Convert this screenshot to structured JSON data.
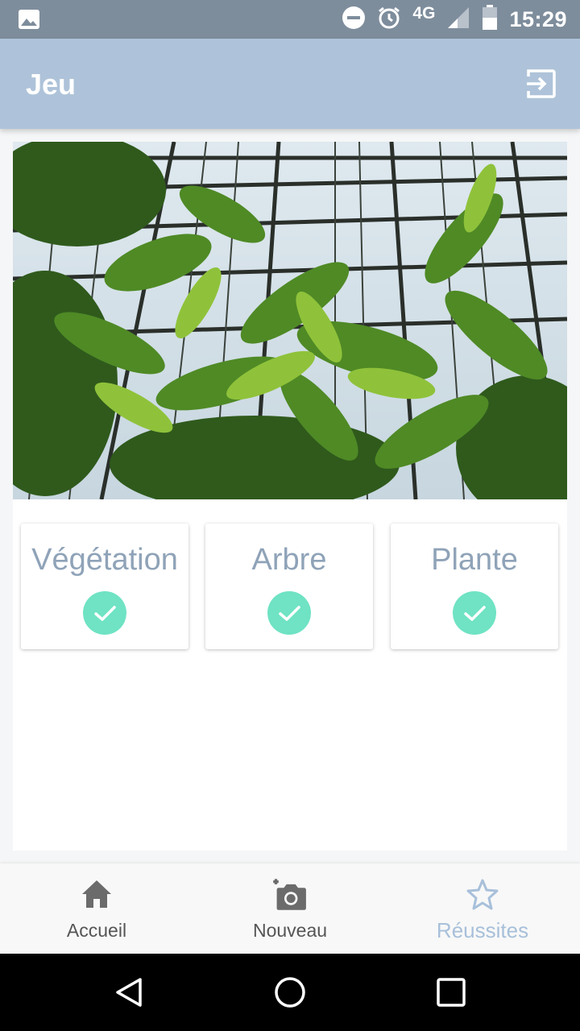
{
  "status_bar": {
    "time": "15:29",
    "network": "4G",
    "icons": [
      "image-icon",
      "do-not-disturb-icon",
      "alarm-icon",
      "signal-icon",
      "battery-icon"
    ]
  },
  "app_bar": {
    "title": "Jeu",
    "action_icon": "logout-icon"
  },
  "photo": {
    "subject": "greenhouse-plants"
  },
  "tags": [
    {
      "label": "Végétation",
      "status_icon": "check-icon"
    },
    {
      "label": "Arbre",
      "status_icon": "check-icon"
    },
    {
      "label": "Plante",
      "status_icon": "check-icon"
    }
  ],
  "bottom_nav": {
    "items": [
      {
        "label": "Accueil",
        "icon": "home-icon"
      },
      {
        "label": "Nouveau",
        "icon": "add-photo-icon"
      },
      {
        "label": "Réussites",
        "icon": "star-icon",
        "active": true
      }
    ]
  },
  "system_nav": [
    "back-icon",
    "home-circle-icon",
    "recents-icon"
  ],
  "colors": {
    "status_bar": "#7e8d9c",
    "app_bar": "#aec3d9",
    "check": "#6fe3c4",
    "tag_text": "#8fa3b8",
    "active_nav": "#a8c0da"
  }
}
